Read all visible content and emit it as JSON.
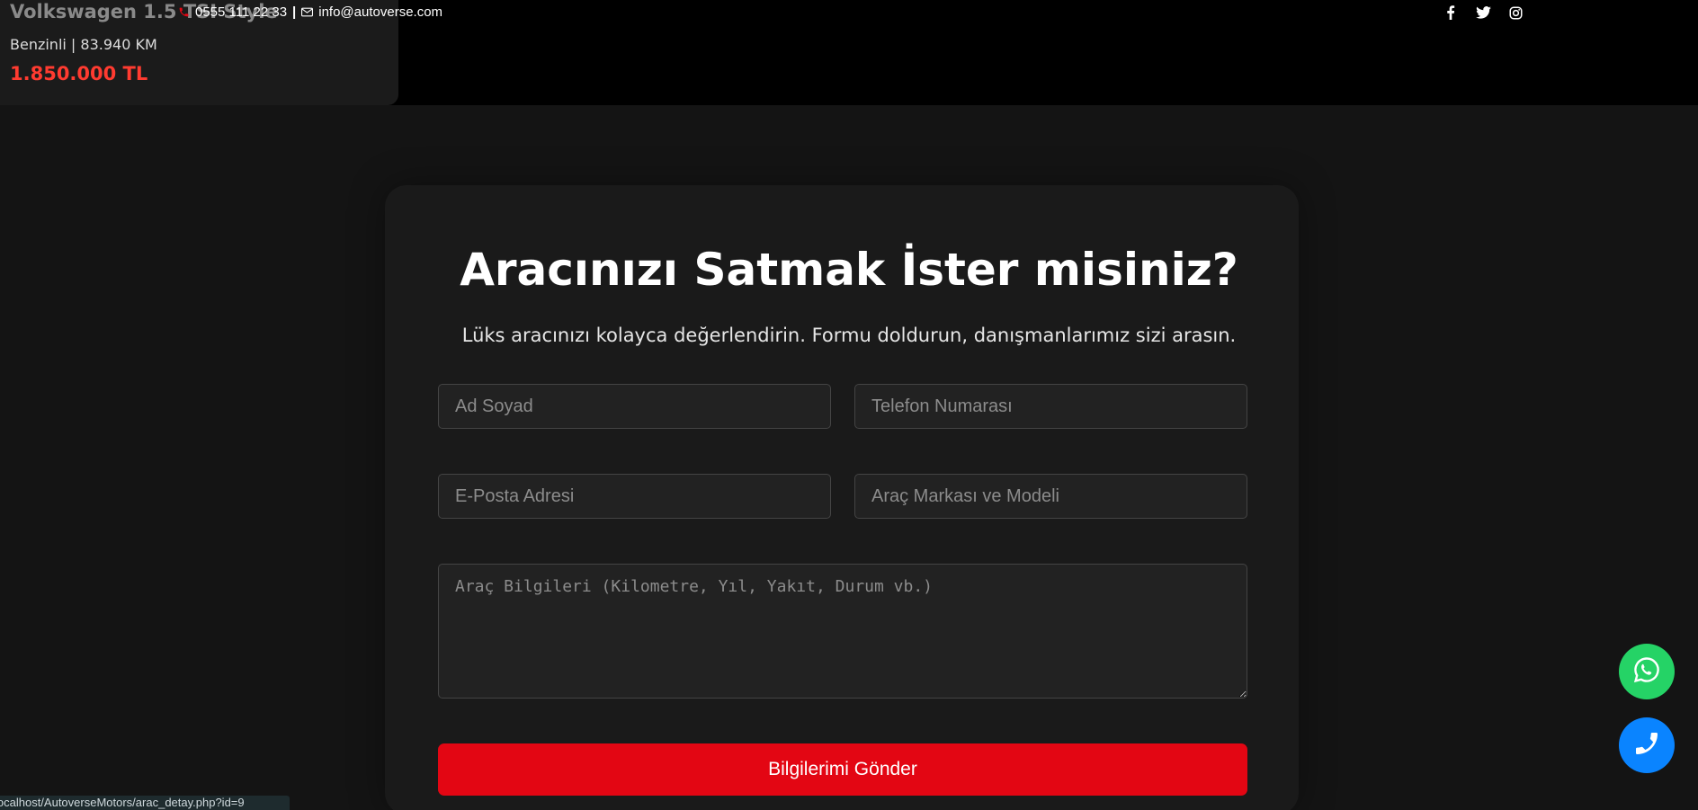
{
  "car": {
    "title": "Volkswagen 1.5 TSI Style",
    "meta": "Benzinli | 83.940 KM",
    "price": "1.850.000 TL"
  },
  "topbar": {
    "phone": "0555 111 22 33",
    "separator": "|",
    "email": "info@autoverse.com",
    "social_icons": [
      "facebook-icon",
      "twitter-icon",
      "instagram-icon"
    ]
  },
  "form": {
    "title": "Aracınızı Satmak İster misiniz?",
    "subtitle": "Lüks aracınızı kolayca değerlendirin. Formu doldurun, danışmanlarımız sizi arasın.",
    "name_placeholder": "Ad Soyad",
    "phone_placeholder": "Telefon Numarası",
    "email_placeholder": "E-Posta Adresi",
    "model_placeholder": "Araç Markası ve Modeli",
    "details_placeholder": "Araç Bilgileri (Kilometre, Yıl, Yakıt, Durum vb.)",
    "submit_label": "Bilgilerimi Gönder"
  },
  "floating": {
    "whatsapp_icon": "whatsapp-icon",
    "call_icon": "phone-icon"
  },
  "status_url": "localhost/AutoverseMotors/arac_detay.php?id=9",
  "colors": {
    "accent_red": "#e30613",
    "price_red": "#ff3b30",
    "whatsapp_green": "#25d366",
    "call_blue": "#0a84ff"
  }
}
